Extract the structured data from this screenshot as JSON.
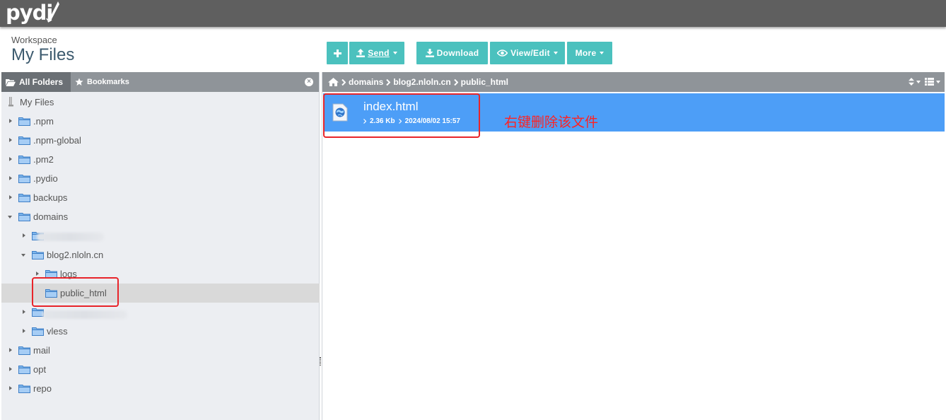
{
  "app": {
    "logo": "pydi"
  },
  "header": {
    "workspace_label": "Workspace",
    "title": "My Files"
  },
  "toolbar": {
    "add_label": "",
    "send_label": "Send",
    "download_label": "Download",
    "view_edit_label": "View/Edit",
    "more_label": "More"
  },
  "left_panel": {
    "tab_all_folders": "All Folders",
    "tab_bookmarks": "Bookmarks",
    "tree": [
      {
        "label": "My Files",
        "depth": 0
      },
      {
        "label": ".npm",
        "depth": 0
      },
      {
        "label": ".npm-global",
        "depth": 0
      },
      {
        "label": ".pm2",
        "depth": 0
      },
      {
        "label": ".pydio",
        "depth": 0
      },
      {
        "label": "backups",
        "depth": 0
      },
      {
        "label": "domains",
        "depth": 0
      },
      {
        "label": "",
        "depth": 1
      },
      {
        "label": "blog2.nloln.cn",
        "depth": 1
      },
      {
        "label": "logs",
        "depth": 2
      },
      {
        "label": "public_html",
        "depth": 2
      },
      {
        "label": "",
        "depth": 1
      },
      {
        "label": "vless",
        "depth": 1
      },
      {
        "label": "mail",
        "depth": 0
      },
      {
        "label": "opt",
        "depth": 0
      },
      {
        "label": "repo",
        "depth": 0
      }
    ]
  },
  "breadcrumb": {
    "items": [
      "domains",
      "blog2.nloln.cn",
      "public_html"
    ]
  },
  "files": [
    {
      "name": "index.html",
      "size": "2.36 Kb",
      "modified": "2024/08/02 15:57"
    }
  ],
  "annotation": {
    "text": "右键删除该文件"
  },
  "colors": {
    "topbar": "#5f5f5f",
    "accent": "#4bc1be",
    "panel_header": "#8f9499",
    "selection": "#4d9ef7",
    "annotation": "#e8242a"
  }
}
